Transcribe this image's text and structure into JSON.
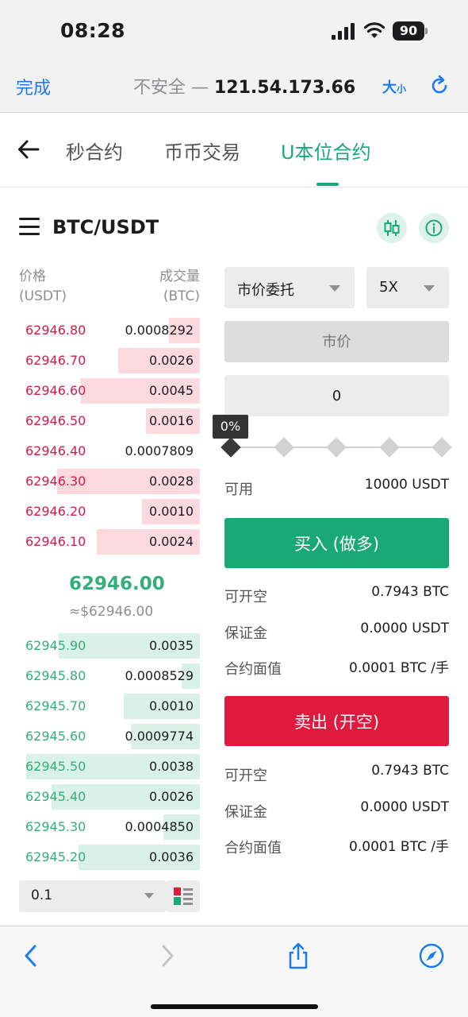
{
  "status_bar": {
    "time": "08:28",
    "battery": "90"
  },
  "address_bar": {
    "done": "完成",
    "insecure": "不安全 —",
    "host": "121.54.173.66",
    "text_size": "大",
    "text_size_small": "小"
  },
  "nav": {
    "tabs": [
      "秒合约",
      "币币交易",
      "U本位合约"
    ],
    "active_index": 2
  },
  "pair": {
    "name": "BTC/USDT"
  },
  "order_book": {
    "price_header": [
      "价格",
      "(USDT)"
    ],
    "volume_header": [
      "成交量",
      "(BTC)"
    ],
    "asks": [
      {
        "price": "62946.80",
        "amount": "0.0008292",
        "depth": 0.17
      },
      {
        "price": "62946.70",
        "amount": "0.0026",
        "depth": 0.45
      },
      {
        "price": "62946.60",
        "amount": "0.0045",
        "depth": 0.66
      },
      {
        "price": "62946.50",
        "amount": "0.0016",
        "depth": 0.3
      },
      {
        "price": "62946.40",
        "amount": "0.0007809",
        "depth": 0.0
      },
      {
        "price": "62946.30",
        "amount": "0.0028",
        "depth": 0.79
      },
      {
        "price": "62946.20",
        "amount": "0.0010",
        "depth": 0.32
      },
      {
        "price": "62946.10",
        "amount": "0.0024",
        "depth": 0.57
      }
    ],
    "last_price": "62946.00",
    "last_price_usd": "≈$62946.00",
    "bids": [
      {
        "price": "62945.90",
        "amount": "0.0035",
        "depth": 0.78
      },
      {
        "price": "62945.80",
        "amount": "0.0008529",
        "depth": 0.1
      },
      {
        "price": "62945.70",
        "amount": "0.0010",
        "depth": 0.42
      },
      {
        "price": "62945.60",
        "amount": "0.0009774",
        "depth": 0.38
      },
      {
        "price": "62945.50",
        "amount": "0.0038",
        "depth": 0.96
      },
      {
        "price": "62945.40",
        "amount": "0.0026",
        "depth": 0.82
      },
      {
        "price": "62945.30",
        "amount": "0.0004850",
        "depth": 0.2
      },
      {
        "price": "62945.20",
        "amount": "0.0036",
        "depth": 0.67
      }
    ],
    "depth_value": "0.1"
  },
  "trade": {
    "order_type": "市价委托",
    "leverage": "5X",
    "price_placeholder": "市价",
    "quantity_value": "0",
    "slider_percent": "0%",
    "available_label": "可用",
    "available_value": "10000 USDT",
    "buy_label": "买入 (做多)",
    "sell_label": "卖出 (开空)",
    "buy_info": [
      {
        "label": "可开空",
        "value": "0.7943 BTC"
      },
      {
        "label": "保证金",
        "value": "0.0000 USDT"
      },
      {
        "label": "合约面值",
        "value": "0.0001 BTC /手"
      }
    ],
    "sell_info": [
      {
        "label": "可开空",
        "value": "0.7943 BTC"
      },
      {
        "label": "保证金",
        "value": "0.0000 USDT"
      },
      {
        "label": "合约面值",
        "value": "0.0001 BTC /手"
      }
    ]
  },
  "colors": {
    "accent": "#1ba97a",
    "buy": "#1aa874",
    "sell": "#e0193f",
    "ask_text": "#d8194a",
    "bid_text": "#33b07a",
    "link": "#1a7cf0"
  }
}
